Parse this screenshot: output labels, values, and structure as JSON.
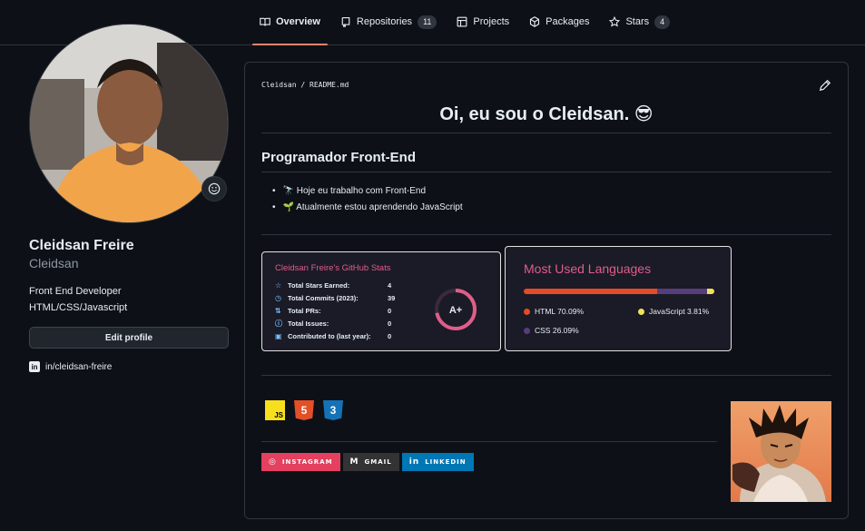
{
  "nav": {
    "tabs": [
      {
        "label": "Overview",
        "icon": "book-icon",
        "active": true
      },
      {
        "label": "Repositories",
        "icon": "repo-icon",
        "count": "11"
      },
      {
        "label": "Projects",
        "icon": "table-icon"
      },
      {
        "label": "Packages",
        "icon": "package-icon"
      },
      {
        "label": "Stars",
        "icon": "star-icon",
        "count": "4"
      }
    ]
  },
  "profile": {
    "fullname": "Cleidsan Freire",
    "login": "Cleidsan",
    "bio_line1": "Front End Developer",
    "bio_line2": "HTML/CSS/Javascript",
    "edit_label": "Edit profile",
    "linkedin": "in/cleidsan-freire"
  },
  "readme": {
    "path_user": "Cleidsan",
    "path_sep": "/",
    "path_file": "README.md",
    "heading": "Oi, eu sou o Cleidsan. 😎",
    "subheading": "Programador Front-End",
    "items": [
      "🔭 Hoje eu trabalho com Front-End",
      "🌱 Atualmente estou aprendendo JavaScript"
    ]
  },
  "stats": {
    "title": "Cleidsan Freire's GitHub Stats",
    "rows": [
      {
        "label": "Total Stars Earned:",
        "value": "4",
        "icon": "☆"
      },
      {
        "label": "Total Commits (2023):",
        "value": "39",
        "icon": "◷"
      },
      {
        "label": "Total PRs:",
        "value": "0",
        "icon": "⇅"
      },
      {
        "label": "Total Issues:",
        "value": "0",
        "icon": "ⓘ"
      },
      {
        "label": "Contributed to (last year):",
        "value": "0",
        "icon": "▣"
      }
    ],
    "grade": "A+"
  },
  "languages": {
    "title": "Most Used Languages",
    "items": [
      {
        "name": "HTML",
        "percent": 70.09,
        "label": "HTML 70.09%",
        "color": "#e34c26"
      },
      {
        "name": "CSS",
        "percent": 26.09,
        "label": "CSS 26.09%",
        "color": "#563d7c"
      },
      {
        "name": "JavaScript",
        "percent": 3.81,
        "label": "JavaScript 3.81%",
        "color": "#f1e05a"
      }
    ]
  },
  "techs": [
    {
      "name": "JS",
      "label": "JS",
      "color": "#f7df1e"
    },
    {
      "name": "HTML5",
      "label": "5",
      "color": "#e34f26"
    },
    {
      "name": "CSS3",
      "label": "3",
      "color": "#1572b6"
    }
  ],
  "badges": [
    {
      "label": "INSTAGRAM",
      "icon": "instagram-icon",
      "color": "#e4405f"
    },
    {
      "label": "GMAIL",
      "icon": "gmail-icon",
      "color": "#333333"
    },
    {
      "label": "LINKEDIN",
      "icon": "linkedin-icon",
      "color": "#0077b5"
    }
  ],
  "colors": {
    "accent": "#f78166",
    "stats_title": "#e05d8a",
    "background": "#0d1117"
  }
}
